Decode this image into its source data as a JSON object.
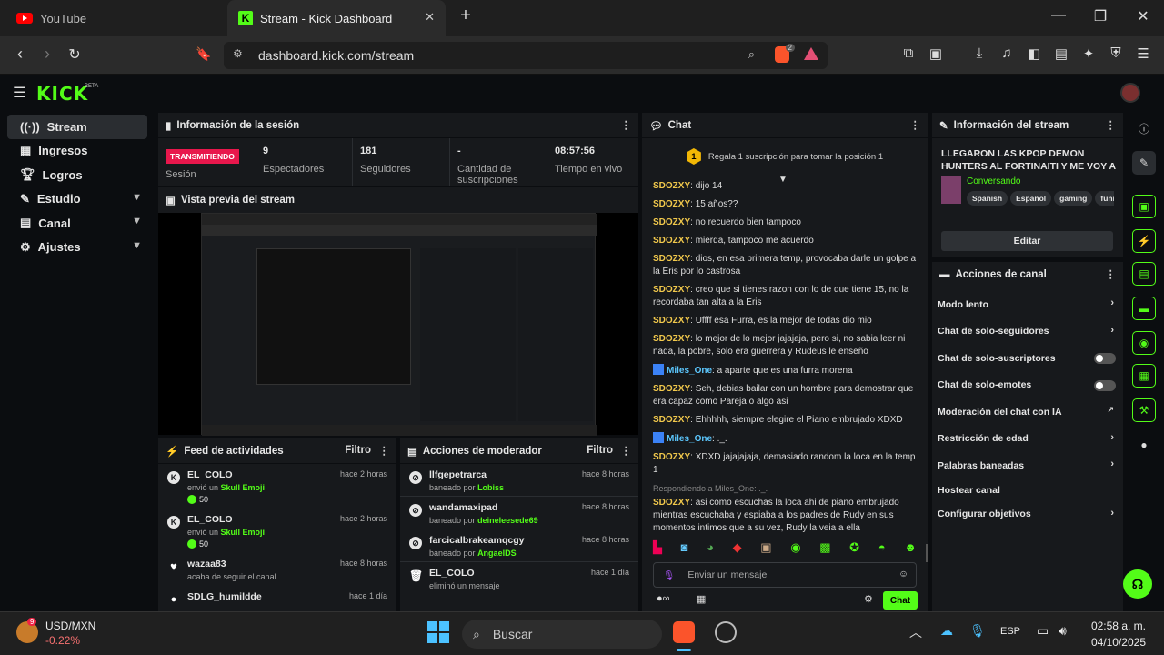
{
  "browser": {
    "tabs": [
      {
        "label": "YouTube",
        "active": false
      },
      {
        "label": "Stream - Kick Dashboard",
        "active": true
      }
    ],
    "url": "dashboard.kick.com/stream",
    "extension_badge": "2"
  },
  "app": {
    "logo": "KICK",
    "logo_badge": "BETA",
    "accent": "#53fc18"
  },
  "sidebar": {
    "items": [
      {
        "label": "Stream",
        "icon": "stream-icon",
        "active": true
      },
      {
        "label": "Ingresos",
        "icon": "income-icon"
      },
      {
        "label": "Logros",
        "icon": "trophy-icon"
      },
      {
        "label": "Estudio",
        "icon": "studio-icon",
        "expandable": true
      },
      {
        "label": "Canal",
        "icon": "channel-icon",
        "expandable": true
      },
      {
        "label": "Ajustes",
        "icon": "gear-icon",
        "expandable": true
      }
    ]
  },
  "session": {
    "title": "Información de la sesión",
    "status": "TRANSMITIENDO",
    "status_label": "Sesión",
    "stats": [
      {
        "value": "9",
        "label": "Espectadores"
      },
      {
        "value": "181",
        "label": "Seguidores"
      },
      {
        "value": "-",
        "label": "Cantidad de suscripciones"
      },
      {
        "value": "08:57:56",
        "label": "Tiempo en vivo"
      }
    ]
  },
  "preview": {
    "title": "Vista previa del stream"
  },
  "feed": {
    "title": "Feed de actividades",
    "filter": "Filtro",
    "items": [
      {
        "name": "EL_COLO",
        "action": "envió un",
        "gift": "Skull Emoji",
        "amount": "50",
        "time": "hace 2 horas",
        "icon": "kick-icon"
      },
      {
        "name": "EL_COLO",
        "action": "envió un",
        "gift": "Skull Emoji",
        "amount": "50",
        "time": "hace 2 horas",
        "icon": "kick-icon"
      },
      {
        "name": "wazaa83",
        "action": "acaba de seguir el canal",
        "time": "hace 8 horas",
        "icon": "heart-icon"
      },
      {
        "name": "SDLG_humildde",
        "time": "hace 1 día",
        "icon": "users-icon"
      }
    ]
  },
  "modactions": {
    "title": "Acciones de moderador",
    "filter": "Filtro",
    "items": [
      {
        "name": "llfgepetrarca",
        "prefix": "baneado por",
        "by": "Lobiss",
        "time": "hace 8 horas",
        "icon": "ban-icon"
      },
      {
        "name": "wandamaxipad",
        "prefix": "baneado por",
        "by": "deineleesede69",
        "time": "hace 8 horas",
        "icon": "ban-icon"
      },
      {
        "name": "farcicalbrakeamqcgy",
        "prefix": "baneado por",
        "by": "AngaelDS",
        "time": "hace 8 horas",
        "icon": "ban-icon"
      },
      {
        "name": "EL_COLO",
        "prefix": "eliminó un mensaje",
        "by": "",
        "time": "hace 1 día",
        "icon": "trash-icon"
      }
    ]
  },
  "chat": {
    "title": "Chat",
    "pinned": "Regala 1 suscripción para tomar la posición 1",
    "pinned_rank": "1",
    "messages": [
      {
        "user": "SDOZXY",
        "text": "dijo 14"
      },
      {
        "user": "SDOZXY",
        "text": "15 años??"
      },
      {
        "user": "SDOZXY",
        "text": "no recuerdo bien tampoco"
      },
      {
        "user": "SDOZXY",
        "text": "mierda, tampoco me acuerdo"
      },
      {
        "user": "SDOZXY",
        "text": "dios, en esa primera temp, provocaba darle un golpe a la Eris por lo castrosa"
      },
      {
        "user": "SDOZXY",
        "text": "creo que si tienes razon con lo de que tiene 15, no la recordaba tan alta a la Eris"
      },
      {
        "user": "SDOZXY",
        "text": "Uffff esa Furra, es la mejor de todas dio mio"
      },
      {
        "user": "SDOZXY",
        "text": "lo mejor de lo mejor jajajaja, pero si, no sabia leer ni nada, la pobre, solo era guerrera y Rudeus le enseño"
      },
      {
        "user": "Miles_One",
        "text": "a aparte que es una furra morena",
        "badge": true
      },
      {
        "user": "SDOZXY",
        "text": "Seh, debias bailar con un hombre para demostrar que era capaz como Pareja o algo asi"
      },
      {
        "user": "SDOZXY",
        "text": "Ehhhhh, siempre elegire el Piano embrujado XDXD"
      },
      {
        "user": "Miles_One",
        "text": "._.",
        "badge": true
      },
      {
        "user": "SDOZXY",
        "text": "XDXD jajajajaja, demasiado random la loca en la temp 1"
      },
      {
        "reply": "Respondiendo a Miles_One: ._."
      },
      {
        "user": "SDOZXY",
        "text": "asi como escuchas la loca ahi de piano embrujado mientras escuchaba y espiaba a los padres de Rudy en sus momentos intimos que a su vez, Rudy la veia a ella"
      }
    ],
    "input_placeholder": "Enviar un mensaje",
    "send_label": "Chat"
  },
  "streaminfo": {
    "title": "Información del stream",
    "stream_title": "LLEGARON LAS KPOP DEMON HUNTERS AL FORTINAITI Y ME VOY A COMPRAR ...",
    "category": "Conversando",
    "tags": [
      "Spanish",
      "Español",
      "gaming",
      "funn"
    ],
    "edit_label": "Editar"
  },
  "channelactions": {
    "title": "Acciones de canal",
    "items": [
      {
        "label": "Modo lento",
        "kind": "chevron"
      },
      {
        "label": "Chat de solo-seguidores",
        "kind": "chevron"
      },
      {
        "label": "Chat de solo-suscriptores",
        "kind": "toggle",
        "on": false
      },
      {
        "label": "Chat de solo-emotes",
        "kind": "toggle",
        "on": false
      },
      {
        "label": "Moderación del chat con IA",
        "kind": "external"
      },
      {
        "label": "Restricción de edad",
        "kind": "chevron"
      },
      {
        "label": "Palabras baneadas",
        "kind": "chevron"
      },
      {
        "label": "Hostear canal",
        "kind": "none"
      },
      {
        "label": "Configurar objetivos",
        "kind": "chevron"
      }
    ]
  },
  "taskbar": {
    "ticker_name": "USD/MXN",
    "ticker_change": "-0.22%",
    "ticker_badge": "9",
    "search_placeholder": "Buscar",
    "language": "ESP",
    "time": "02:58 a. m.",
    "date": "04/10/2025"
  }
}
